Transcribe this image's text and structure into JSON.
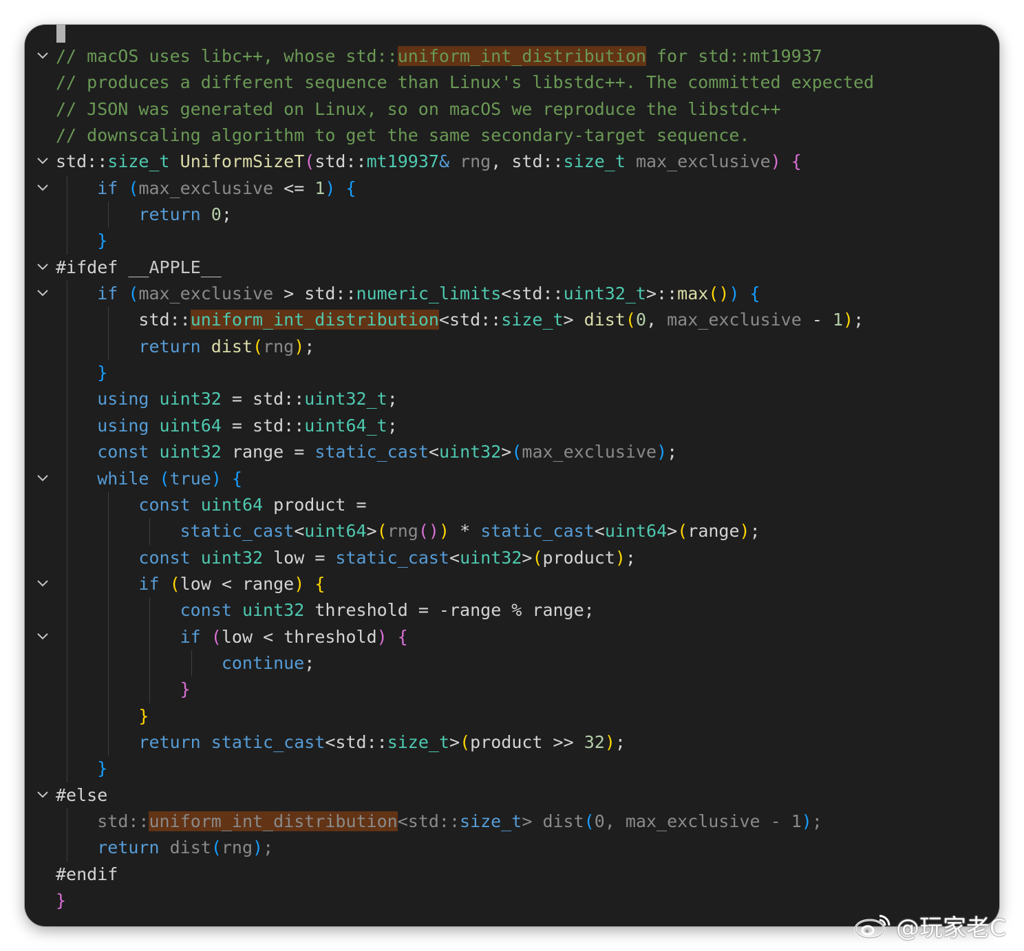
{
  "editor": {
    "language": "cpp",
    "theme_colors": {
      "background": "#1e1e1e",
      "comment": "#6a9955",
      "keyword": "#569cd6",
      "type": "#4ec9b0",
      "function": "#dcdcaa",
      "number": "#b5cea8",
      "highlight": "#623315"
    },
    "fold_icon": "chevron-down-icon",
    "lines": [
      {
        "fold": true,
        "indent": 0,
        "tokens": [
          [
            "cm",
            "// macOS uses libc++, whose std::"
          ],
          [
            "cm hl",
            "uniform_int_distribution"
          ],
          [
            "cm",
            " for std::mt19937"
          ]
        ]
      },
      {
        "fold": false,
        "indent": 0,
        "tokens": [
          [
            "cm",
            "// produces a different sequence than Linux's libstdc++. The committed expected"
          ]
        ]
      },
      {
        "fold": false,
        "indent": 0,
        "tokens": [
          [
            "cm",
            "// JSON was generated on Linux, so on macOS we reproduce the libstdc++"
          ]
        ]
      },
      {
        "fold": false,
        "indent": 0,
        "tokens": [
          [
            "cm",
            "// downscaling algorithm to get the same secondary-target sequence."
          ]
        ]
      },
      {
        "fold": true,
        "indent": 0,
        "tokens": [
          [
            "op",
            "std::"
          ],
          [
            "ty",
            "size_t"
          ],
          [
            "op",
            " "
          ],
          [
            "df",
            "UniformSizeT"
          ],
          [
            "b2",
            "("
          ],
          [
            "op",
            "std::"
          ],
          [
            "ty",
            "mt19937"
          ],
          [
            "kw",
            "&"
          ],
          [
            "op",
            " "
          ],
          [
            "pmd",
            "rng"
          ],
          [
            "op",
            ", std::"
          ],
          [
            "ty",
            "size_t"
          ],
          [
            "op",
            " "
          ],
          [
            "pmd",
            "max_exclusive"
          ],
          [
            "b2",
            ")"
          ],
          [
            "op",
            " "
          ],
          [
            "b2",
            "{"
          ]
        ]
      },
      {
        "fold": true,
        "indent": 1,
        "tokens": [
          [
            "kw",
            "if"
          ],
          [
            "op",
            " "
          ],
          [
            "b3",
            "("
          ],
          [
            "pmd",
            "max_exclusive"
          ],
          [
            "op",
            " <= "
          ],
          [
            "nm",
            "1"
          ],
          [
            "b3",
            ")"
          ],
          [
            "op",
            " "
          ],
          [
            "b3",
            "{"
          ]
        ]
      },
      {
        "fold": false,
        "indent": 2,
        "tokens": [
          [
            "kw",
            "return"
          ],
          [
            "op",
            " "
          ],
          [
            "nm",
            "0"
          ],
          [
            "op",
            ";"
          ]
        ]
      },
      {
        "fold": false,
        "indent": 1,
        "tokens": [
          [
            "b3",
            "}"
          ]
        ]
      },
      {
        "fold": true,
        "indent": 0,
        "tokens": [
          [
            "op",
            "#ifdef "
          ],
          [
            "mc",
            "__APPLE__"
          ]
        ]
      },
      {
        "fold": true,
        "indent": 1,
        "tokens": [
          [
            "kw",
            "if"
          ],
          [
            "op",
            " "
          ],
          [
            "b3",
            "("
          ],
          [
            "pmd",
            "max_exclusive"
          ],
          [
            "op",
            " > std::"
          ],
          [
            "ty",
            "numeric_limits"
          ],
          [
            "op",
            "<std::"
          ],
          [
            "ty",
            "uint32_t"
          ],
          [
            "op",
            ">::"
          ],
          [
            "df",
            "max"
          ],
          [
            "b1",
            "()"
          ],
          [
            "b3",
            ")"
          ],
          [
            "op",
            " "
          ],
          [
            "b3",
            "{"
          ]
        ]
      },
      {
        "fold": false,
        "indent": 2,
        "tokens": [
          [
            "op",
            "std::"
          ],
          [
            "ty hl",
            "uniform_int_distribution"
          ],
          [
            "op",
            "<std::"
          ],
          [
            "ty",
            "size_t"
          ],
          [
            "op",
            "> "
          ],
          [
            "df",
            "dist"
          ],
          [
            "b1",
            "("
          ],
          [
            "nm",
            "0"
          ],
          [
            "op",
            ", "
          ],
          [
            "pmd",
            "max_exclusive"
          ],
          [
            "op",
            " - "
          ],
          [
            "nm",
            "1"
          ],
          [
            "b1",
            ")"
          ],
          [
            "op",
            ";"
          ]
        ]
      },
      {
        "fold": false,
        "indent": 2,
        "tokens": [
          [
            "kw",
            "return"
          ],
          [
            "op",
            " "
          ],
          [
            "df",
            "dist"
          ],
          [
            "b1",
            "("
          ],
          [
            "pmd",
            "rng"
          ],
          [
            "b1",
            ")"
          ],
          [
            "op",
            ";"
          ]
        ]
      },
      {
        "fold": false,
        "indent": 1,
        "tokens": [
          [
            "b3",
            "}"
          ]
        ]
      },
      {
        "fold": false,
        "indent": 1,
        "tokens": [
          [
            "kw",
            "using"
          ],
          [
            "op",
            " "
          ],
          [
            "ty",
            "uint32"
          ],
          [
            "op",
            " = std::"
          ],
          [
            "ty",
            "uint32_t"
          ],
          [
            "op",
            ";"
          ]
        ]
      },
      {
        "fold": false,
        "indent": 1,
        "tokens": [
          [
            "kw",
            "using"
          ],
          [
            "op",
            " "
          ],
          [
            "ty",
            "uint64"
          ],
          [
            "op",
            " = std::"
          ],
          [
            "ty",
            "uint64_t"
          ],
          [
            "op",
            ";"
          ]
        ]
      },
      {
        "fold": false,
        "indent": 1,
        "tokens": [
          [
            "kw",
            "const"
          ],
          [
            "op",
            " "
          ],
          [
            "ty",
            "uint32"
          ],
          [
            "op",
            " range = "
          ],
          [
            "kw",
            "static_cast"
          ],
          [
            "op",
            "<"
          ],
          [
            "ty",
            "uint32"
          ],
          [
            "op",
            ">"
          ],
          [
            "b3",
            "("
          ],
          [
            "pmd",
            "max_exclusive"
          ],
          [
            "b3",
            ")"
          ],
          [
            "op",
            ";"
          ]
        ]
      },
      {
        "fold": true,
        "indent": 1,
        "tokens": [
          [
            "kw",
            "while"
          ],
          [
            "op",
            " "
          ],
          [
            "b3",
            "("
          ],
          [
            "kw",
            "true"
          ],
          [
            "b3",
            ")"
          ],
          [
            "op",
            " "
          ],
          [
            "b3",
            "{"
          ]
        ]
      },
      {
        "fold": false,
        "indent": 2,
        "tokens": [
          [
            "kw",
            "const"
          ],
          [
            "op",
            " "
          ],
          [
            "ty",
            "uint64"
          ],
          [
            "op",
            " product ="
          ]
        ]
      },
      {
        "fold": false,
        "indent": 3,
        "tokens": [
          [
            "kw",
            "static_cast"
          ],
          [
            "op",
            "<"
          ],
          [
            "ty",
            "uint64"
          ],
          [
            "op",
            ">"
          ],
          [
            "b1",
            "("
          ],
          [
            "pmd",
            "rng"
          ],
          [
            "b2",
            "()"
          ],
          [
            "b1",
            ")"
          ],
          [
            "op",
            " * "
          ],
          [
            "kw",
            "static_cast"
          ],
          [
            "op",
            "<"
          ],
          [
            "ty",
            "uint64"
          ],
          [
            "op",
            ">"
          ],
          [
            "b1",
            "("
          ],
          [
            "op",
            "range"
          ],
          [
            "b1",
            ")"
          ],
          [
            "op",
            ";"
          ]
        ]
      },
      {
        "fold": false,
        "indent": 2,
        "tokens": [
          [
            "kw",
            "const"
          ],
          [
            "op",
            " "
          ],
          [
            "ty",
            "uint32"
          ],
          [
            "op",
            " low = "
          ],
          [
            "kw",
            "static_cast"
          ],
          [
            "op",
            "<"
          ],
          [
            "ty",
            "uint32"
          ],
          [
            "op",
            ">"
          ],
          [
            "b1",
            "("
          ],
          [
            "op",
            "product"
          ],
          [
            "b1",
            ")"
          ],
          [
            "op",
            ";"
          ]
        ]
      },
      {
        "fold": true,
        "indent": 2,
        "tokens": [
          [
            "kw",
            "if"
          ],
          [
            "op",
            " "
          ],
          [
            "b1",
            "("
          ],
          [
            "op",
            "low < range"
          ],
          [
            "b1",
            ")"
          ],
          [
            "op",
            " "
          ],
          [
            "b1",
            "{"
          ]
        ]
      },
      {
        "fold": false,
        "indent": 3,
        "tokens": [
          [
            "kw",
            "const"
          ],
          [
            "op",
            " "
          ],
          [
            "ty",
            "uint32"
          ],
          [
            "op",
            " threshold = -range % range;"
          ]
        ]
      },
      {
        "fold": true,
        "indent": 3,
        "tokens": [
          [
            "kw",
            "if"
          ],
          [
            "op",
            " "
          ],
          [
            "b2",
            "("
          ],
          [
            "op",
            "low < threshold"
          ],
          [
            "b2",
            ")"
          ],
          [
            "op",
            " "
          ],
          [
            "b2",
            "{"
          ]
        ]
      },
      {
        "fold": false,
        "indent": 4,
        "tokens": [
          [
            "kw",
            "continue"
          ],
          [
            "op",
            ";"
          ]
        ]
      },
      {
        "fold": false,
        "indent": 3,
        "tokens": [
          [
            "b2",
            "}"
          ]
        ]
      },
      {
        "fold": false,
        "indent": 2,
        "tokens": [
          [
            "b1",
            "}"
          ]
        ]
      },
      {
        "fold": false,
        "indent": 2,
        "tokens": [
          [
            "kw",
            "return"
          ],
          [
            "op",
            " "
          ],
          [
            "kw",
            "static_cast"
          ],
          [
            "op",
            "<std::"
          ],
          [
            "ty",
            "size_t"
          ],
          [
            "op",
            ">"
          ],
          [
            "b1",
            "("
          ],
          [
            "op",
            "product >> "
          ],
          [
            "nm",
            "32"
          ],
          [
            "b1",
            ")"
          ],
          [
            "op",
            ";"
          ]
        ]
      },
      {
        "fold": false,
        "indent": 1,
        "tokens": [
          [
            "b3",
            "}"
          ]
        ]
      },
      {
        "fold": true,
        "indent": 0,
        "tokens": [
          [
            "op",
            "#else"
          ]
        ]
      },
      {
        "fold": false,
        "indent": 1,
        "tokens": [
          [
            "pmd",
            "std::"
          ],
          [
            "pmd hl",
            "uniform_int_distribution"
          ],
          [
            "pmd",
            "<std::"
          ],
          [
            "kw",
            "size_t"
          ],
          [
            "pmd",
            "> "
          ],
          [
            "pmd",
            "dist"
          ],
          [
            "b3",
            "("
          ],
          [
            "pmd",
            "0"
          ],
          [
            "pmd",
            ", max_exclusive - "
          ],
          [
            "pmd",
            "1"
          ],
          [
            "b3",
            ")"
          ],
          [
            "pmd",
            ";"
          ]
        ]
      },
      {
        "fold": false,
        "indent": 1,
        "tokens": [
          [
            "kw",
            "return"
          ],
          [
            "op",
            " "
          ],
          [
            "pmd",
            "dist"
          ],
          [
            "b3",
            "("
          ],
          [
            "pmd",
            "rng"
          ],
          [
            "b3",
            ")"
          ],
          [
            "pmd",
            ";"
          ]
        ]
      },
      {
        "fold": false,
        "indent": 0,
        "tokens": [
          [
            "op",
            "#endif"
          ]
        ]
      },
      {
        "fold": false,
        "indent": 0,
        "tokens": [
          [
            "b2",
            "}"
          ]
        ]
      }
    ],
    "indent_guides": {
      "level1_lines": [
        5,
        6,
        7,
        9,
        10,
        11,
        12,
        13,
        14,
        15,
        16,
        17,
        18,
        19,
        20,
        21,
        22,
        23,
        24,
        25,
        26,
        27,
        29,
        30
      ],
      "level2_lines": [
        6,
        10,
        11,
        17,
        18,
        19,
        20,
        21,
        22,
        23,
        24,
        25,
        26
      ],
      "level3_lines": [
        18,
        21,
        22,
        23,
        24
      ],
      "level4_lines": [
        23
      ]
    }
  },
  "watermark": {
    "icon": "weibo-icon",
    "text": "@玩家老C"
  }
}
